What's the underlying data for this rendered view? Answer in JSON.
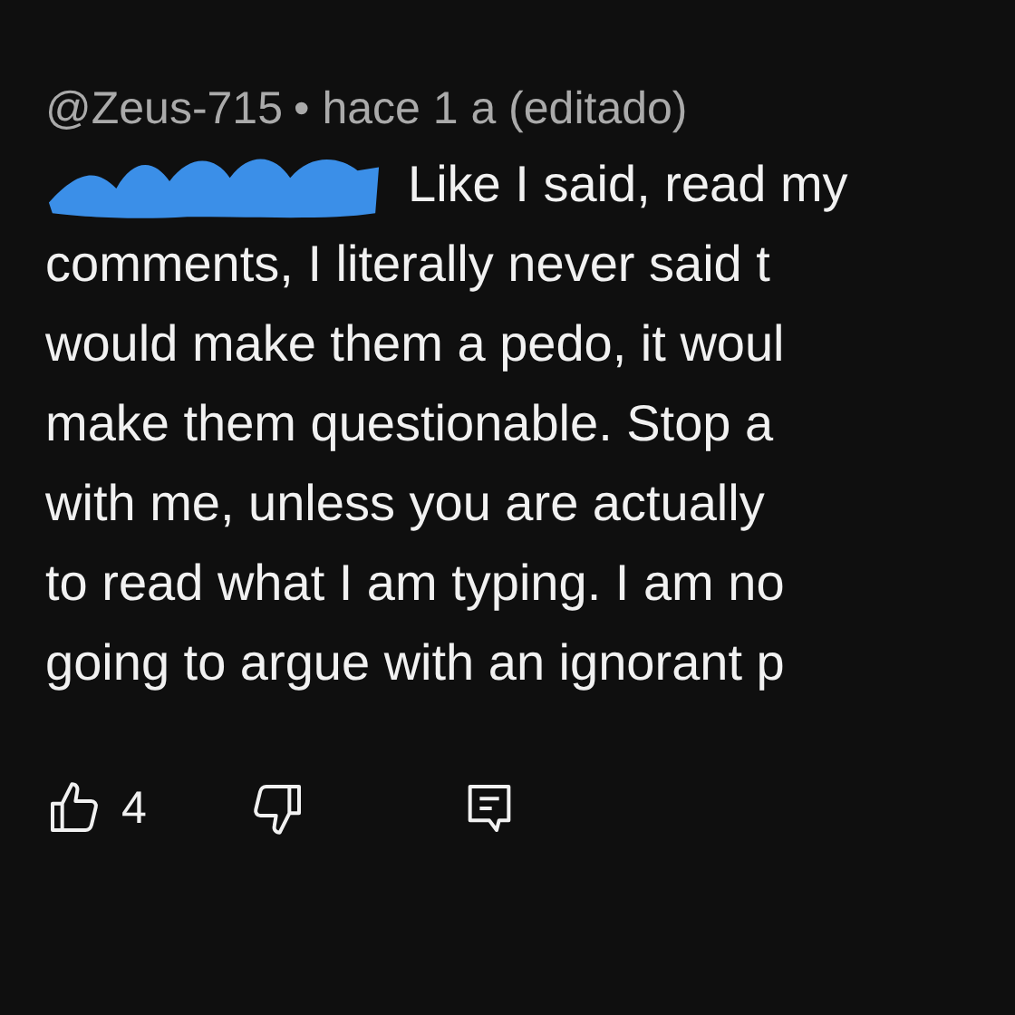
{
  "comment": {
    "author": "@Zeus-715",
    "meta": "• hace 1 a (editado)",
    "redacted_start": true,
    "lines": [
      "Like I said, read my",
      "comments, I literally never said t",
      "would make them a pedo, it woul",
      "make them questionable. Stop a",
      "with me, unless you are actually",
      "to read what I am typing. I am no",
      "going to argue with an ignorant p"
    ],
    "likes": "4"
  }
}
